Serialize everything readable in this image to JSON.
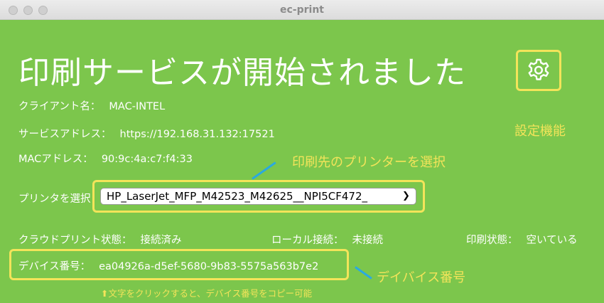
{
  "window": {
    "title": "ec-print"
  },
  "main": {
    "headline": "印刷サービスが開始されました",
    "client_name": {
      "label": "クライアント名：",
      "value": "MAC-INTEL"
    },
    "service_address": {
      "label": "サービスアドレス：",
      "value": "https://192.168.31.132:17521"
    },
    "mac_address": {
      "label": "MACアドレス：",
      "value": "90:9c:4a:c7:f4:33"
    },
    "printer_select": {
      "label": "プリンタを選択",
      "selected": "HP_LaserJet_MFP_M42523_M42625__NPI5CF472_"
    },
    "cloud_status": {
      "label": "クラウドプリント状態：",
      "value": "接続済み"
    },
    "local_connection": {
      "label": "ローカル接続：",
      "value": "未接続"
    },
    "print_status": {
      "label": "印刷状態：",
      "value": "空いている"
    },
    "device_number": {
      "label": "デバイス番号：",
      "value": "ea04926a-d5ef-5680-9b83-5575a563b7e2"
    },
    "copy_hint": "⬆文字をクリックすると、デバイス番号をコピー可能"
  },
  "annotations": {
    "settings": "設定機能",
    "printer": "印刷先のプリンターを選択",
    "device": "デイバイス番号"
  },
  "colors": {
    "background": "#7cc64c",
    "highlight": "#f3e45a",
    "arrow": "#2aa9e0"
  }
}
